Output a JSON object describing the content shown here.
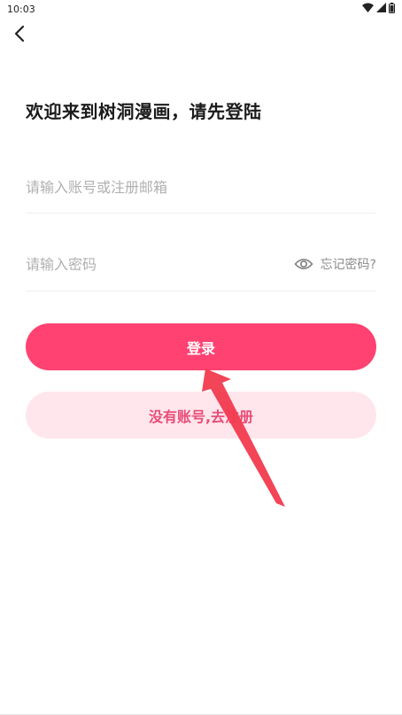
{
  "status_bar": {
    "time": "10:03",
    "icons": [
      "wifi-icon",
      "signal-icon",
      "battery-icon"
    ]
  },
  "header": {
    "back_icon": "chevron-left-icon",
    "title": "欢迎来到树洞漫画，请先登陆"
  },
  "form": {
    "account_placeholder": "请输入账号或注册邮箱",
    "account_value": "",
    "password_placeholder": "请输入密码",
    "password_value": "",
    "password_visibility_icon": "eye-icon",
    "forgot_password": "忘记密码?"
  },
  "actions": {
    "login_label": "登录",
    "register_label": "没有账号,去注册"
  },
  "colors": {
    "accent": "#ff4271",
    "secondary_bg": "#ffe6ec",
    "secondary_text": "#e94c77",
    "annotation_arrow": "#f23b4f"
  },
  "annotation": {
    "type": "arrow",
    "target": "login-button"
  }
}
